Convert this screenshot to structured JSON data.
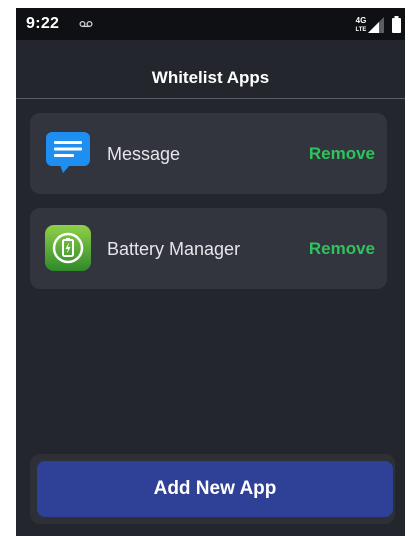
{
  "status_bar": {
    "time": "9:22",
    "network_label": "4G LTE",
    "icons": [
      "voicemail-icon",
      "network-icon",
      "signal-icon",
      "battery-icon"
    ]
  },
  "header": {
    "title": "Whitelist Apps"
  },
  "apps": [
    {
      "name": "Message",
      "icon": "message-icon",
      "action_label": "Remove"
    },
    {
      "name": "Battery Manager",
      "icon": "battery-manager-icon",
      "action_label": "Remove"
    }
  ],
  "footer": {
    "add_label": "Add New App"
  },
  "colors": {
    "background": "#24262d",
    "status_bar": "#0f1013",
    "card": "#33353e",
    "remove_text": "#2fc35e",
    "add_button": "#2f4097"
  }
}
